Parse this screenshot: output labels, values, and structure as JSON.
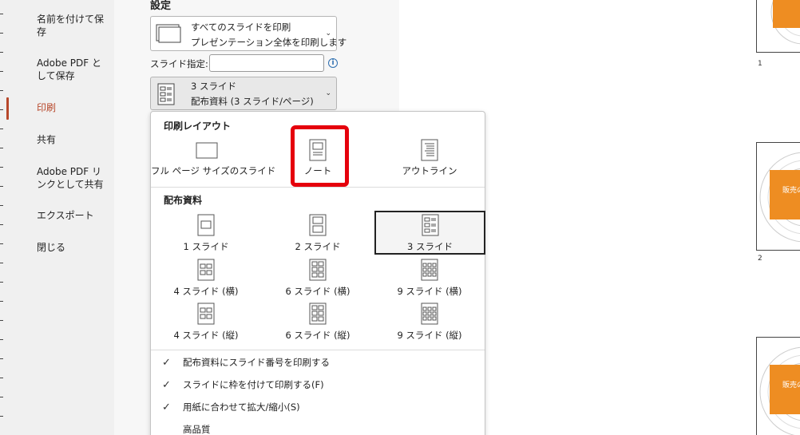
{
  "sidebar": {
    "items": [
      {
        "label": "名前を付けて保存"
      },
      {
        "label": "Adobe PDF として保存"
      },
      {
        "label": "印刷"
      },
      {
        "label": "共有"
      },
      {
        "label": "Adobe PDF リンクとして共有"
      },
      {
        "label": "エクスポート"
      },
      {
        "label": "閉じる"
      }
    ],
    "active_item": "印刷"
  },
  "settings": {
    "title": "設定",
    "print_range": {
      "line1": "すべてのスライドを印刷",
      "line2": "プレゼンテーション全体を印刷します"
    },
    "slide_spec": {
      "label": "スライド指定:",
      "value": ""
    },
    "layout": {
      "line1": "3 スライド",
      "line2": "配布資料 (3 スライド/ページ)"
    }
  },
  "dropdown": {
    "print_layout_heading": "印刷レイアウト",
    "print_layouts": [
      {
        "label": "フル ページ サイズのスライド",
        "icon": "full-page-slide-icon"
      },
      {
        "label": "ノート",
        "icon": "notes-page-icon"
      },
      {
        "label": "アウトライン",
        "icon": "outline-page-icon"
      }
    ],
    "highlighted_layout": "ノート",
    "handouts_heading": "配布資料",
    "handouts": [
      {
        "label": "1 スライド",
        "icon": "handout-1-icon"
      },
      {
        "label": "2 スライド",
        "icon": "handout-2-icon"
      },
      {
        "label": "3 スライド",
        "icon": "handout-3-icon"
      },
      {
        "label": "4 スライド (横)",
        "icon": "handout-4-horizontal-icon"
      },
      {
        "label": "6 スライド (横)",
        "icon": "handout-6-horizontal-icon"
      },
      {
        "label": "9 スライド (横)",
        "icon": "handout-9-horizontal-icon"
      },
      {
        "label": "4 スライド (縦)",
        "icon": "handout-4-vertical-icon"
      },
      {
        "label": "6 スライド (縦)",
        "icon": "handout-6-vertical-icon"
      },
      {
        "label": "9 スライド (縦)",
        "icon": "handout-9-vertical-icon"
      }
    ],
    "selected_handout": "3 スライド",
    "options": [
      {
        "label": "配布資料にスライド番号を印刷する",
        "checked": true
      },
      {
        "label": "スライドに枠を付けて印刷する(F)",
        "checked": true
      },
      {
        "label": "用紙に合わせて拡大/縮小(S)",
        "checked": true
      },
      {
        "label": "高品質",
        "checked": false
      }
    ]
  },
  "preview": {
    "thumbnails": [
      {
        "number": "1",
        "text": ""
      },
      {
        "number": "2",
        "text": "販売の"
      },
      {
        "number": "",
        "text": "販売の"
      }
    ]
  },
  "colors": {
    "accent": "#b7472a",
    "highlight": "#e5000c",
    "orange": "#ee8d22"
  }
}
